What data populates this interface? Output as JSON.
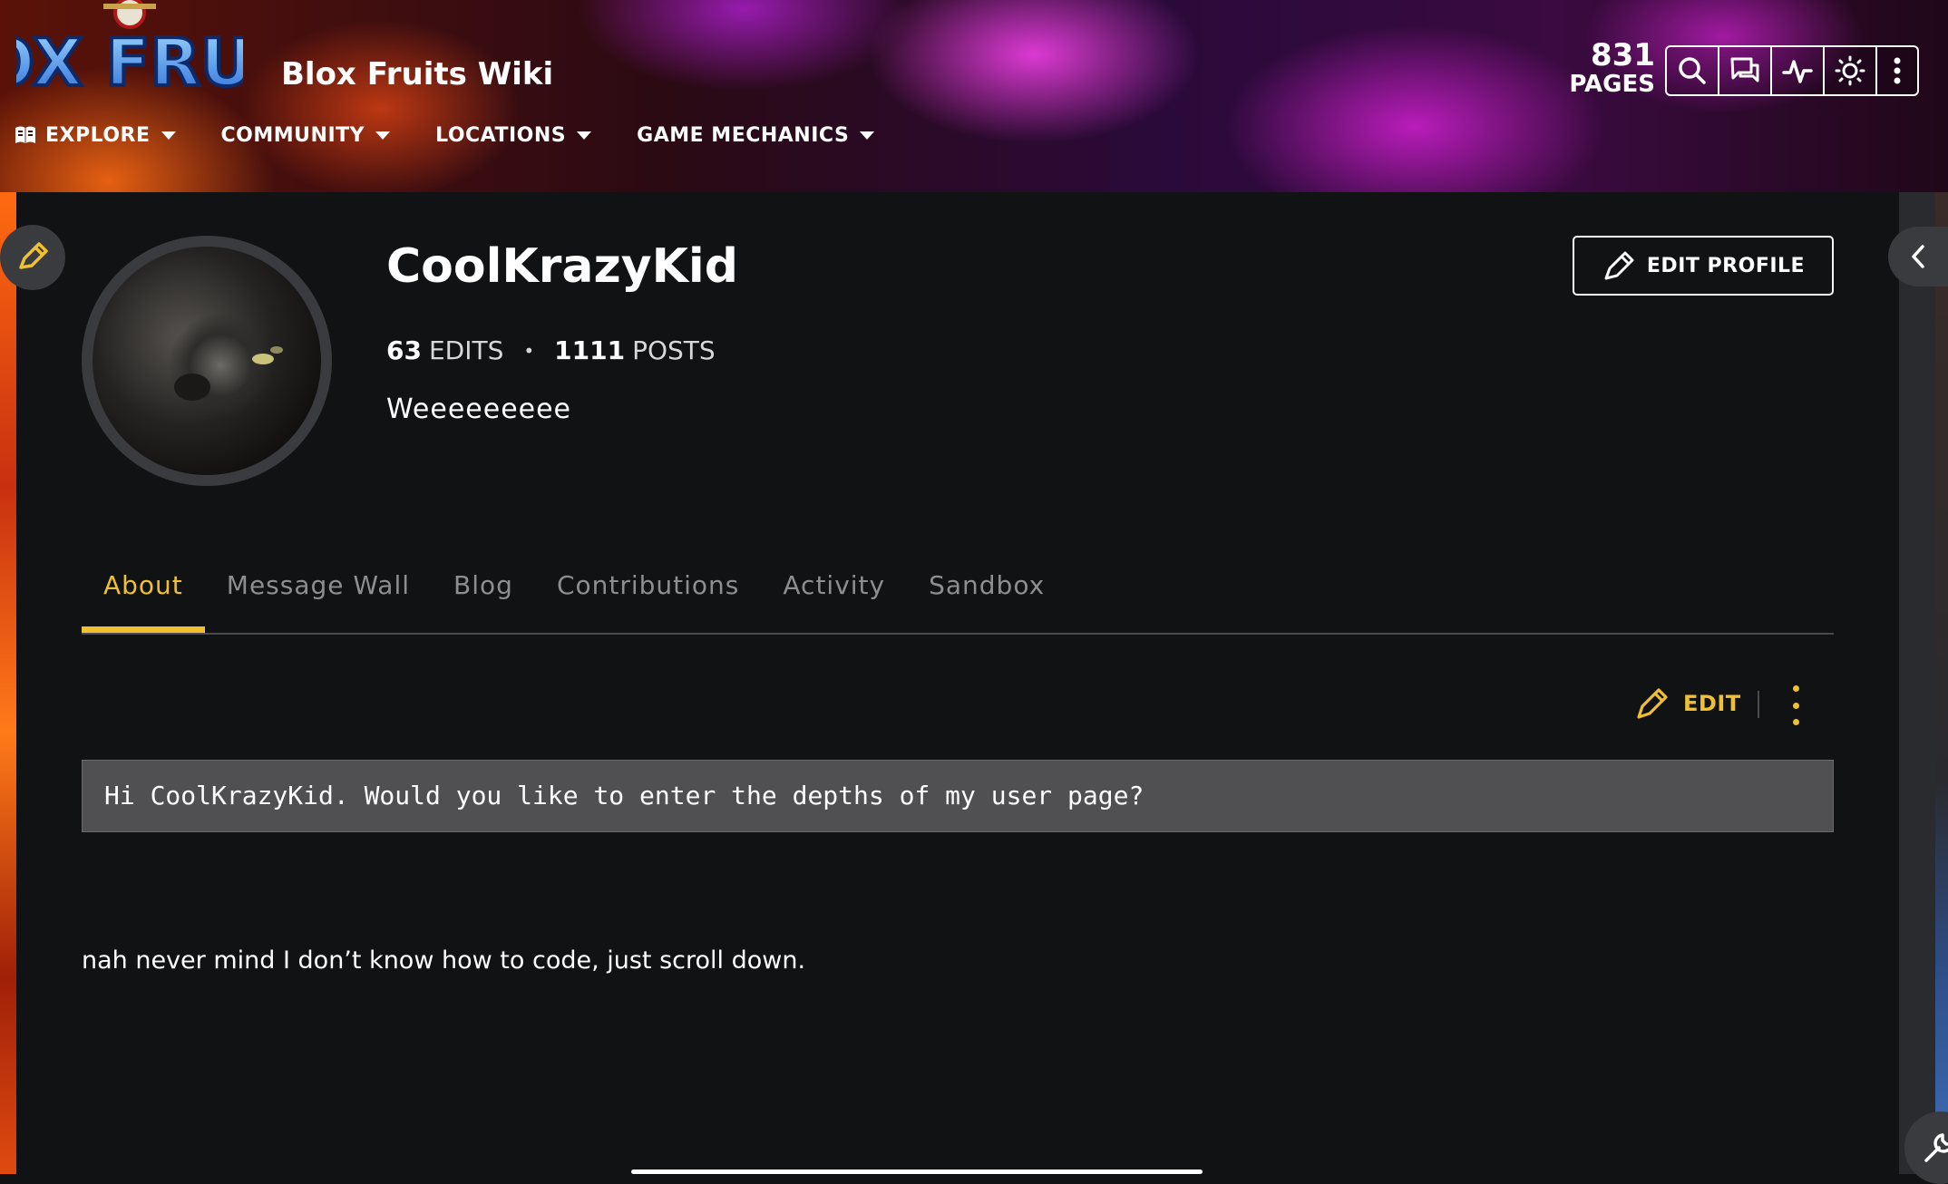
{
  "header": {
    "logo_text": "BLOX FRUITS",
    "wiki_title": "Blox Fruits Wiki",
    "nav": [
      {
        "label": "EXPLORE"
      },
      {
        "label": "COMMUNITY"
      },
      {
        "label": "LOCATIONS"
      },
      {
        "label": "GAME MECHANICS"
      }
    ],
    "pages_count": "831",
    "pages_label": "PAGES",
    "tools": [
      "search-icon",
      "discussions-icon",
      "activity-icon",
      "theme-toggle-icon",
      "more-options-icon"
    ]
  },
  "profile": {
    "username": "CoolKrazyKid",
    "edits_count": "63",
    "edits_label": "EDITS",
    "posts_count": "1111",
    "posts_label": "POSTS",
    "bio": "Weeeeeeeee",
    "edit_profile_label": "EDIT PROFILE"
  },
  "tabs": [
    {
      "label": "About",
      "active": true
    },
    {
      "label": "Message Wall"
    },
    {
      "label": "Blog"
    },
    {
      "label": "Contributions"
    },
    {
      "label": "Activity"
    },
    {
      "label": "Sandbox"
    }
  ],
  "content": {
    "edit_label": "EDIT",
    "code_text": "Hi CoolKrazyKid. Would you like to enter the depths of my user page?",
    "body_text": "nah never mind I don’t know how to code, just scroll down."
  },
  "colors": {
    "accent": "#f0c030",
    "background": "#111214",
    "code_bg": "#505052"
  }
}
